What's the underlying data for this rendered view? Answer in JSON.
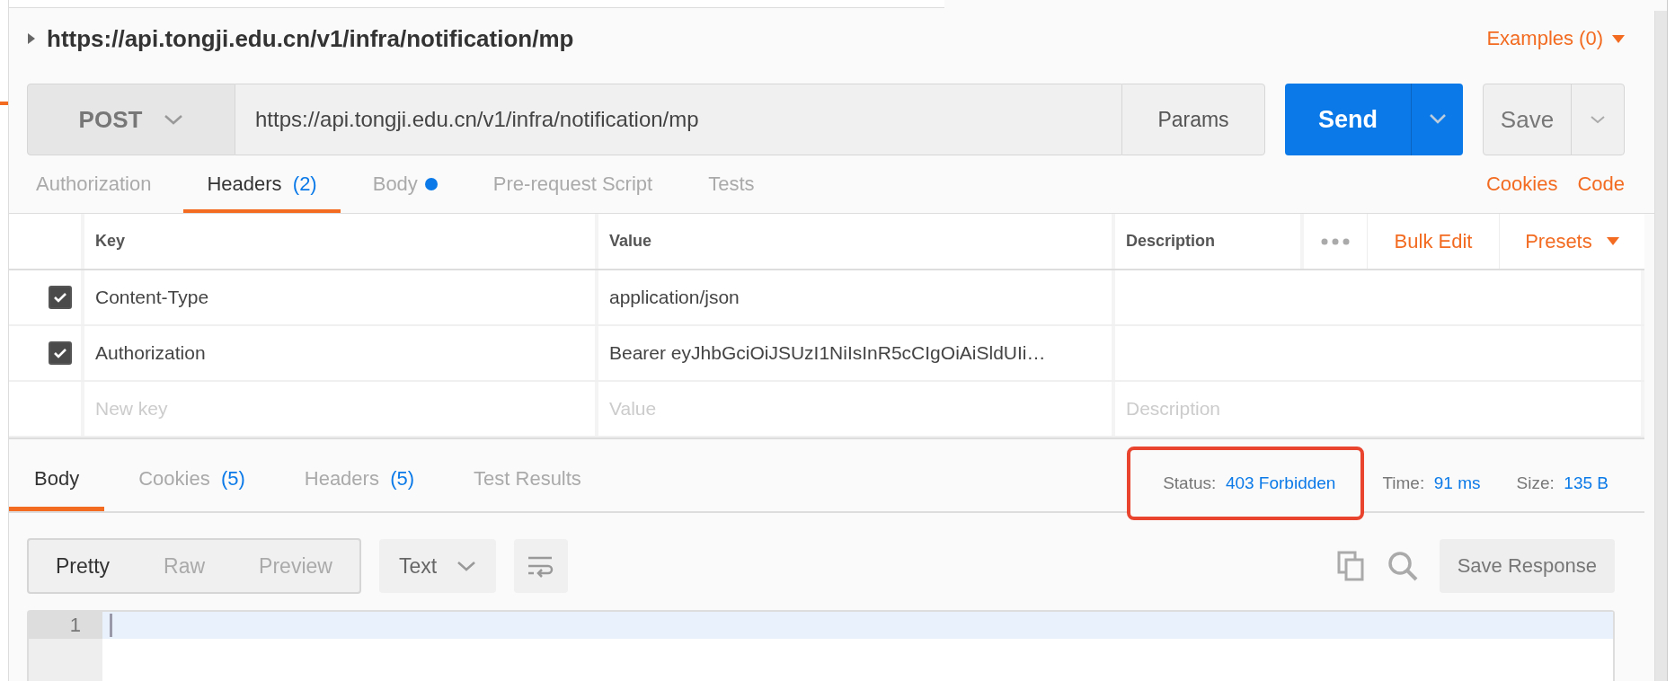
{
  "request_title": {
    "text": "https://api.tongji.edu.cn/v1/infra/notification/mp",
    "expanded": false
  },
  "examples_link": "Examples (0)",
  "request": {
    "method": "POST",
    "url": "https://api.tongji.edu.cn/v1/infra/notification/mp",
    "params_label": "Params",
    "send_label": "Send",
    "save_label": "Save"
  },
  "request_tabs": [
    {
      "label": "Authorization",
      "selected": false
    },
    {
      "label": "Headers",
      "count": "(2)",
      "selected": true
    },
    {
      "label": "Body",
      "has_content": true,
      "selected": false
    },
    {
      "label": "Pre-request Script",
      "selected": false
    },
    {
      "label": "Tests",
      "selected": false
    }
  ],
  "request_links": [
    "Cookies",
    "Code"
  ],
  "headers_table": {
    "columns": [
      "Key",
      "Value",
      "Description"
    ],
    "bulk_edit": "Bulk Edit",
    "presets": "Presets",
    "rows": [
      {
        "key": "Content-Type",
        "value": "application/json",
        "checked": true
      },
      {
        "key": "Authorization",
        "value": "Bearer eyJhbGciOiJSUzI1NiIsInR5cCIgOiAiSldUIi…",
        "checked": true
      }
    ],
    "new_row": {
      "key_placeholder": "New key",
      "value_placeholder": "Value",
      "description_placeholder": "Description"
    }
  },
  "response_tabs": [
    {
      "label": "Body",
      "selected": true
    },
    {
      "label": "Cookies",
      "count": "(5)",
      "selected": false
    },
    {
      "label": "Headers",
      "count": "(5)",
      "selected": false
    },
    {
      "label": "Test Results",
      "selected": false
    }
  ],
  "status": {
    "label": "Status:",
    "value": "403 Forbidden",
    "highlighted": true
  },
  "time": {
    "label": "Time:",
    "value": "91 ms"
  },
  "size": {
    "label": "Size:",
    "value": "135 B"
  },
  "body_toolbar": {
    "view_modes": [
      {
        "label": "Pretty",
        "selected": true
      },
      {
        "label": "Raw",
        "selected": false
      },
      {
        "label": "Preview",
        "selected": false
      }
    ],
    "format": "Text",
    "save_response": "Save Response"
  },
  "editor": {
    "line_numbers": [
      "1"
    ]
  }
}
